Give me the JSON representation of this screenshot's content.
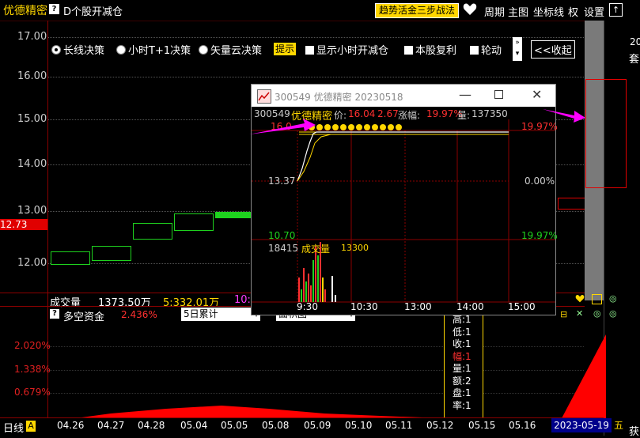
{
  "topbar": {
    "stock_name": "优德精密",
    "help": "?",
    "title": "D个股开减仓",
    "trend_button": "趋势活金三步战法",
    "period": "周期",
    "main_chart": "主图",
    "axis": "坐标线",
    "quan": "权",
    "settings": "设置",
    "up": "↑"
  },
  "price_axis": [
    "17.00",
    "16.00",
    "15.00",
    "14.00",
    "13.00",
    "12.00"
  ],
  "current_price": "12.73",
  "controls": {
    "opt1": "长线决策",
    "opt2": "小时T+1决策",
    "opt3": "矢量云决策",
    "hint": "提示",
    "cb1": "显示小时开减仓",
    "cb2": "本股复利",
    "cb3": "轮动",
    "collapse": "<<收起"
  },
  "volume_bar": {
    "label": "成交量",
    "value": "1373.50万",
    "ma5": "5:332.01万",
    "ma10": "10:"
  },
  "fund_panel": {
    "help": "?",
    "title": "多空资金",
    "value": "2.436%",
    "dropdown1": "5日累计",
    "dropdown2": "面积图",
    "levels": [
      "2.020%",
      "1.338%",
      "0.679%"
    ]
  },
  "popup": {
    "title": "300549 优德精密 20230518",
    "code": "300549",
    "name": "优德精密",
    "price_label": "价:",
    "price": "16.04",
    "change": "2.67",
    "pct_label": "涨幅:",
    "pct": "19.97%",
    "vol_label": "量:",
    "vol": "137350",
    "y_top": "16.0",
    "y_mid": "13.37",
    "y_low": "10.70",
    "r_top": "19.97%",
    "r_mid": "0.00%",
    "r_low": "19.97%",
    "vol_max": "18415",
    "vol_title": "成交量",
    "vol_value": "13300",
    "times": [
      "9:30",
      "10:30",
      "13:00",
      "14:00",
      "15:00"
    ]
  },
  "tooltip": [
    "高:1",
    "低:1",
    "收:1",
    "幅:1",
    "量:1",
    "额:2",
    "盘:1",
    "率:1"
  ],
  "x_axis": {
    "period": "日线",
    "flag": "A",
    "dates": [
      "04.26",
      "04.27",
      "04.28",
      "05.04",
      "05.05",
      "05.08",
      "05.09",
      "05.10",
      "05.11",
      "05.12",
      "05.15",
      "05.16"
    ],
    "current_date": "2023-05-19",
    "weekday": "五"
  },
  "right_panel": {
    "top_text": "20",
    "mid_text": "套",
    "bottom_text": "获"
  },
  "chart_data": {
    "type": "line",
    "title": "",
    "x": [
      "9:30",
      "10:30",
      "13:00",
      "14:00",
      "15:00"
    ],
    "series": [
      {
        "name": "",
        "values": [
          13.37,
          16.04,
          16.04,
          16.04,
          16.04
        ]
      }
    ],
    "ylim": [
      10.7,
      16.04
    ]
  }
}
